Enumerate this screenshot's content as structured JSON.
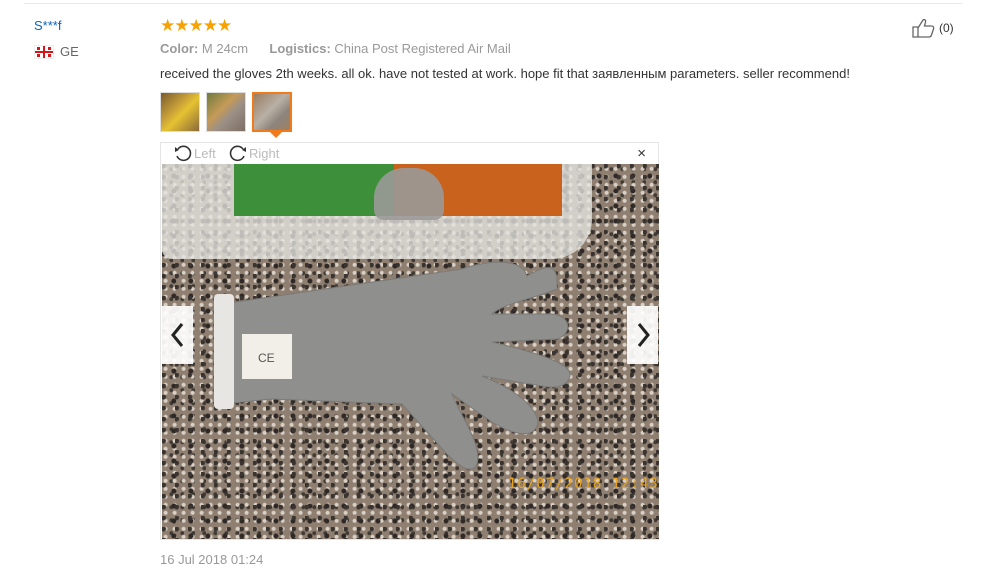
{
  "reviewer": {
    "name": "S***f",
    "country_code": "GE"
  },
  "rating": {
    "stars": 5,
    "max": 5,
    "display": "★★★★★"
  },
  "order_info": {
    "color_label": "Color:",
    "color_value": "M 24cm",
    "logistics_label": "Logistics:",
    "logistics_value": "China Post Registered Air Mail"
  },
  "review_text": "received the gloves 2th weeks. all ok. have not tested at work. hope fit that заявленным parameters. seller recommend!",
  "helpful": {
    "count": "(0)",
    "icon": "thumbs-up-icon"
  },
  "thumbnails": [
    {
      "name": "review-photo-thumb-1",
      "selected": false
    },
    {
      "name": "review-photo-thumb-2",
      "selected": false
    },
    {
      "name": "review-photo-thumb-3",
      "selected": true
    }
  ],
  "viewer": {
    "rotate_left_label": "Left",
    "rotate_right_label": "Right",
    "close_glyph": "×",
    "photo_stamp": "16/07/2018  12:43",
    "photo_label_text": "CE"
  },
  "review_date": "16 Jul 2018 01:24",
  "colors": {
    "star": "#f7a200",
    "username": "#0b63c5",
    "selected_border": "#f27a1a"
  }
}
